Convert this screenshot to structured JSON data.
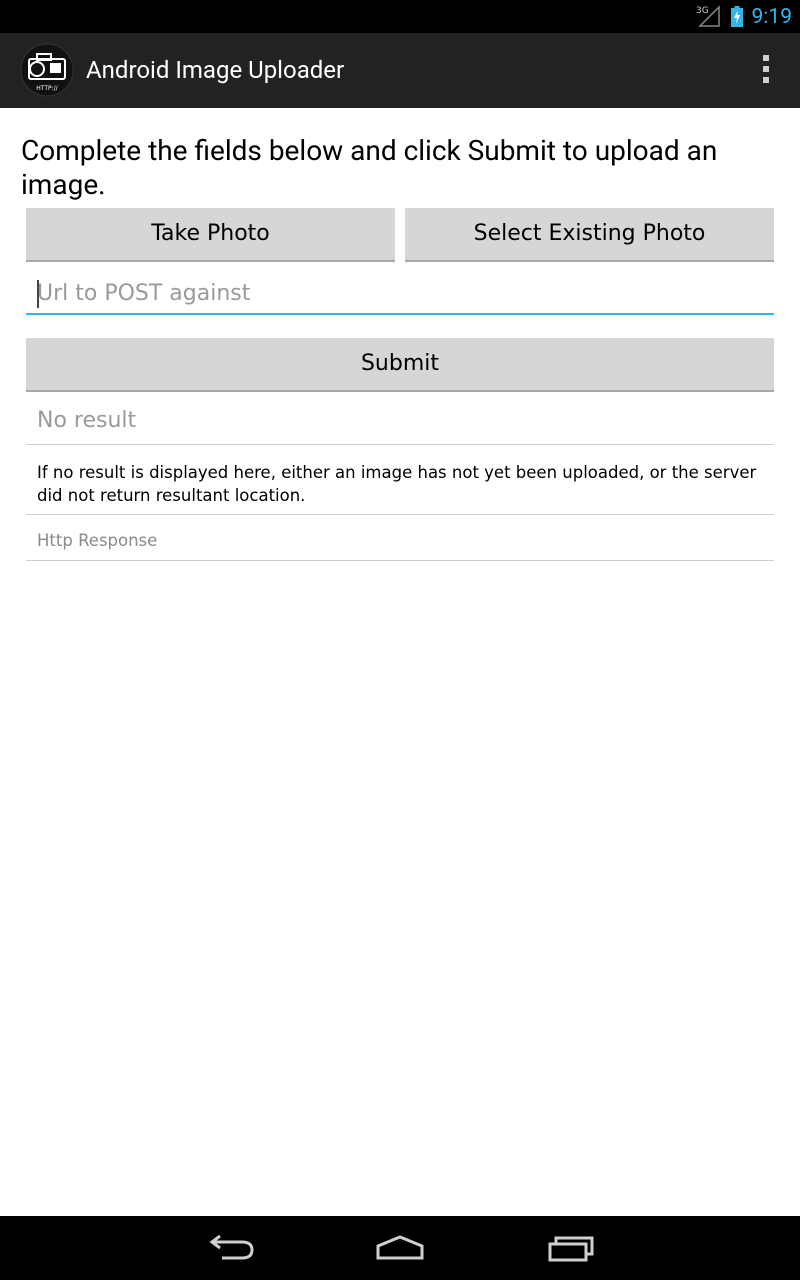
{
  "status_bar": {
    "network_type": "3G",
    "time": "9:19",
    "accent_color": "#33b5e5"
  },
  "action_bar": {
    "app_icon_text": "HTTP://",
    "title": "Android Image Uploader",
    "overflow_icon": "overflow-menu-icon"
  },
  "form": {
    "instructions": "Complete the fields below and click Submit to upload an image.",
    "take_photo_label": "Take Photo",
    "select_existing_label": "Select Existing Photo",
    "url_value": "",
    "url_placeholder": "Url to POST against",
    "submit_label": "Submit",
    "result_text": "No result",
    "help_text": "If no result is displayed here, either an image has not yet been uploaded, or the server did not return resultant location.",
    "http_response_text": "Http Response"
  },
  "nav_bar": {
    "back_icon": "back-icon",
    "home_icon": "home-icon",
    "recents_icon": "recents-icon"
  }
}
